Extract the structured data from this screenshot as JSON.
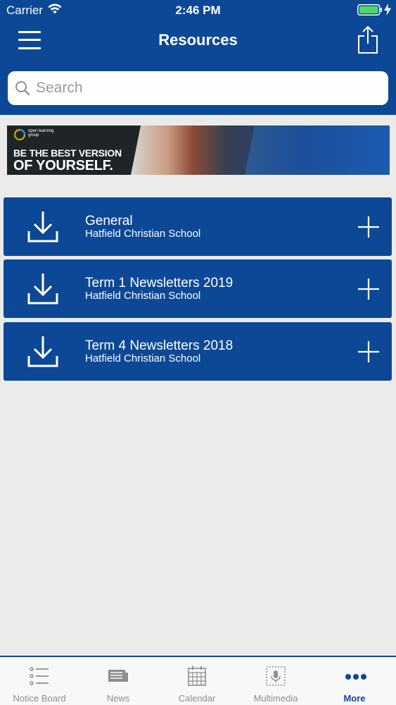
{
  "status_bar": {
    "carrier": "Carrier",
    "time": "2:46 PM",
    "battery_color": "#4cd964"
  },
  "header": {
    "title": "Resources",
    "menu_icon": "hamburger-menu-icon",
    "share_icon": "share-icon"
  },
  "search": {
    "placeholder": "Search",
    "icon": "search-icon"
  },
  "banner": {
    "brand": "open learning group",
    "line1": "BE THE BEST VERSION",
    "line2": "OF YOURSELF."
  },
  "resources": [
    {
      "name": "General",
      "school": "Hatfield Christian School"
    },
    {
      "name": "Term 1 Newsletters 2019",
      "school": "Hatfield Christian School"
    },
    {
      "name": "Term 4 Newsletters 2018",
      "school": "Hatfield Christian School"
    }
  ],
  "tab_bar": {
    "active": "More",
    "tabs": [
      {
        "label": "Notice Board",
        "icon": "list-icon"
      },
      {
        "label": "News",
        "icon": "newspaper-icon"
      },
      {
        "label": "Calendar",
        "icon": "calendar-icon"
      },
      {
        "label": "Multimedia",
        "icon": "microphone-icon"
      },
      {
        "label": "More",
        "icon": "more-dots-icon"
      }
    ]
  },
  "colors": {
    "brand_blue": "#0c4896",
    "background": "#ebebeb",
    "inactive_tab": "#8e8e8e"
  }
}
